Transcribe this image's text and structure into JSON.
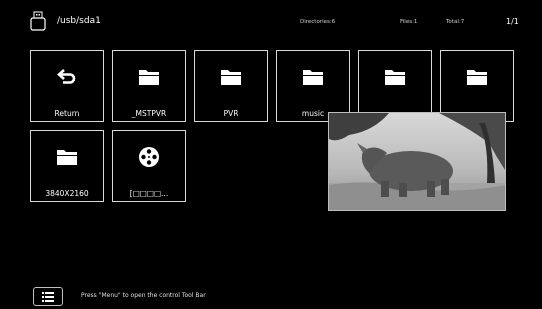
{
  "header": {
    "path": "/usb/sda1",
    "directories": "Directories:6",
    "files": "Files:1",
    "total": "Total:7",
    "page": "1/1"
  },
  "tiles": [
    {
      "label": "Return",
      "icon": "return-arrow-icon"
    },
    {
      "label": "_MSTPVR",
      "icon": "folder-icon"
    },
    {
      "label": "PVR",
      "icon": "folder-icon"
    },
    {
      "label": "music",
      "icon": "folder-icon"
    },
    {
      "label": "",
      "icon": "folder-icon"
    },
    {
      "label": "",
      "icon": "folder-icon"
    },
    {
      "label": "3840X2160",
      "icon": "folder-icon"
    },
    {
      "label": "[□□□□...",
      "icon": "film-reel-icon"
    }
  ],
  "preview": {
    "subject": "rhinoceros"
  },
  "footer": {
    "hint": "Press \"Menu\" to open the control Tool Bar",
    "icon": "menu-list-icon"
  },
  "colors": {
    "background": "#000000",
    "border": "#d8d8d8",
    "text": "#ffffff"
  }
}
